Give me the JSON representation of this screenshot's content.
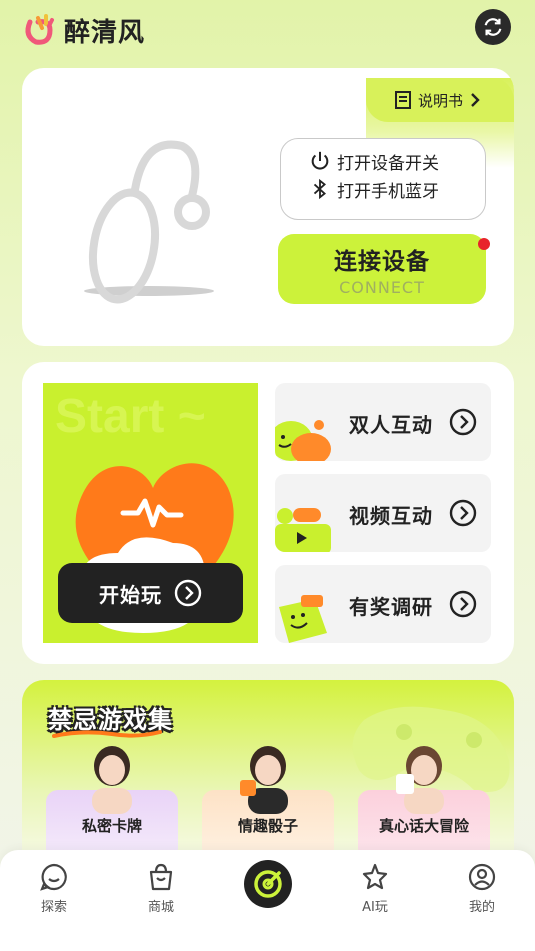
{
  "header": {
    "app_name": "醉清风",
    "refresh_icon": "refresh-icon"
  },
  "device_card": {
    "manual_label": "说明书",
    "hint_power": "打开设备开关",
    "hint_bluetooth": "打开手机蓝牙",
    "connect_title": "连接设备",
    "connect_sub": "CONNECT",
    "status_color": "#e8242b"
  },
  "play_card": {
    "start_watermark": "Start ~",
    "start_label": "开始玩",
    "modes": [
      {
        "label": "双人互动"
      },
      {
        "label": "视频互动"
      },
      {
        "label": "有奖调研"
      }
    ]
  },
  "games": {
    "title": "禁忌游戏集",
    "items": [
      {
        "label": "私密卡牌"
      },
      {
        "label": "情趣骰子"
      },
      {
        "label": "真心话大冒险"
      }
    ]
  },
  "nav": {
    "items": [
      {
        "label": "探索",
        "icon": "explore-icon"
      },
      {
        "label": "商城",
        "icon": "shop-bag-icon"
      },
      {
        "label": "",
        "icon": "center-target-icon"
      },
      {
        "label": "AI玩",
        "icon": "ai-star-icon"
      },
      {
        "label": "我的",
        "icon": "profile-icon"
      }
    ]
  },
  "colors": {
    "accent": "#ccf23a",
    "dark": "#222222",
    "orange": "#ff7a1a"
  }
}
